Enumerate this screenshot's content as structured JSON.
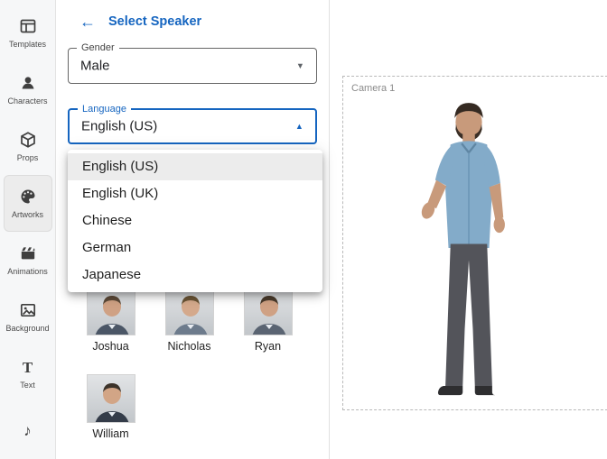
{
  "colors": {
    "accent": "#1565c0",
    "sidebar_bg": "#f6f7f8",
    "menu_selected_bg": "#ececec"
  },
  "icons": {
    "back": "←",
    "chevron_down": "▼",
    "chevron_up": "▲",
    "text_glyph": "T",
    "music_note": "♪"
  },
  "sidebar": {
    "items": [
      {
        "id": "templates",
        "label": "Templates"
      },
      {
        "id": "characters",
        "label": "Characters"
      },
      {
        "id": "props",
        "label": "Props"
      },
      {
        "id": "artworks",
        "label": "Artworks",
        "selected": true
      },
      {
        "id": "animations",
        "label": "Animations"
      },
      {
        "id": "background",
        "label": "Background"
      },
      {
        "id": "text",
        "label": "Text"
      },
      {
        "id": "music"
      }
    ]
  },
  "panel": {
    "title": "Select Speaker",
    "gender": {
      "label": "Gender",
      "value": "Male"
    },
    "language": {
      "label": "Language",
      "value": "English (US)"
    },
    "language_options": [
      {
        "label": "English (US)",
        "selected": true
      },
      {
        "label": "English (UK)",
        "selected": false
      },
      {
        "label": "Chinese",
        "selected": false
      },
      {
        "label": "German",
        "selected": false
      },
      {
        "label": "Japanese",
        "selected": false
      }
    ],
    "speakers": [
      {
        "name": "Joshua"
      },
      {
        "name": "Nicholas"
      },
      {
        "name": "Ryan"
      },
      {
        "name": "William"
      }
    ]
  },
  "canvas": {
    "camera_label": "Camera 1"
  }
}
